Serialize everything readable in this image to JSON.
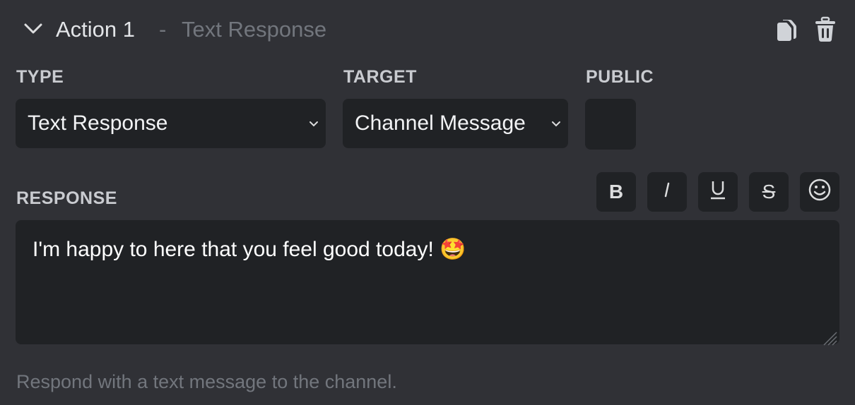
{
  "header": {
    "title": "Action 1",
    "separator": "-",
    "subtitle": "Text Response",
    "icons": {
      "collapse": "chevron-down-icon",
      "duplicate": "copy-icon",
      "delete": "trash-icon"
    }
  },
  "fields": {
    "type": {
      "label": "TYPE",
      "value": "Text Response"
    },
    "target": {
      "label": "TARGET",
      "value": "Channel Message"
    },
    "public": {
      "label": "PUBLIC",
      "checked": false
    }
  },
  "response": {
    "label": "RESPONSE",
    "value": "I'm happy to here that you feel good today! 🤩",
    "toolbar": [
      {
        "name": "bold",
        "glyph": "B"
      },
      {
        "name": "italic",
        "glyph": "/"
      },
      {
        "name": "underline",
        "glyph": "U"
      },
      {
        "name": "strikethrough",
        "glyph": "S"
      },
      {
        "name": "emoji",
        "glyph": "☺"
      }
    ]
  },
  "help_text": "Respond with a text message to the channel.",
  "colors": {
    "background": "#303136",
    "input_background": "#202225",
    "muted_text": "#72767d",
    "text": "#dcddde"
  }
}
